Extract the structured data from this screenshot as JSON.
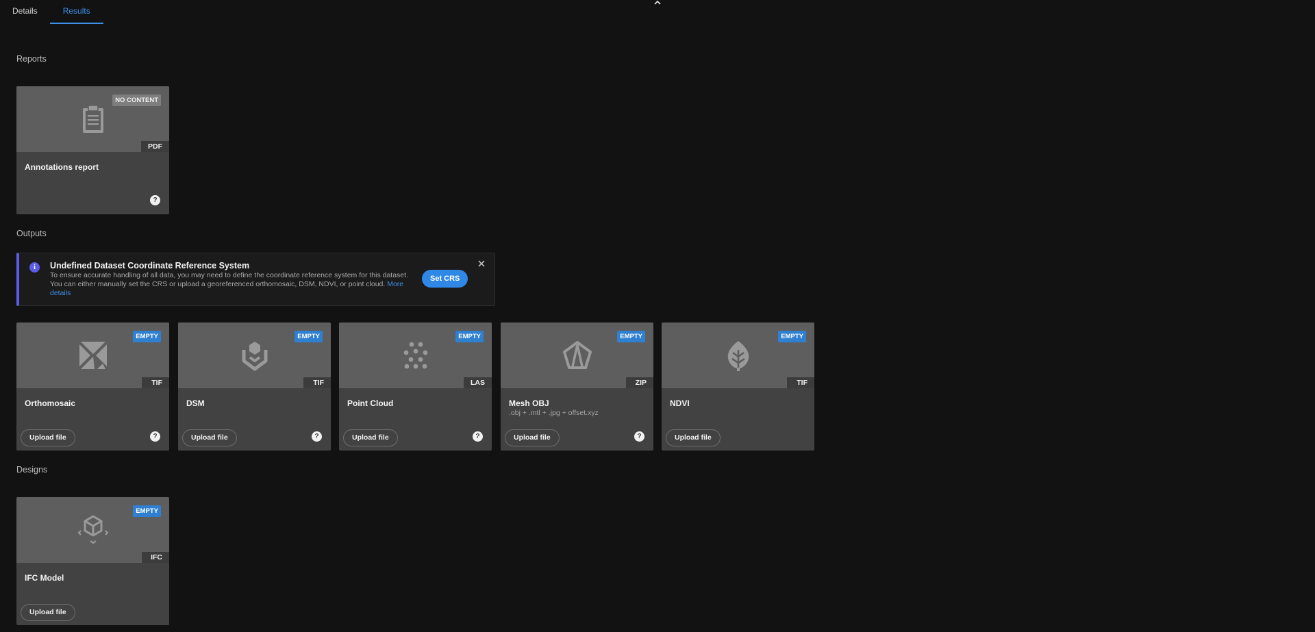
{
  "tabs": [
    {
      "label": "Details",
      "active": false
    },
    {
      "label": "Results",
      "active": true
    }
  ],
  "sections": {
    "reports": "Reports",
    "outputs": "Outputs",
    "designs": "Designs"
  },
  "reports": [
    {
      "title": "Annotations report",
      "badge": "NO CONTENT",
      "ext": "PDF",
      "icon": "clipboard-icon",
      "help": "?"
    }
  ],
  "alert": {
    "title": "Undefined Dataset Coordinate Reference System",
    "body": "To ensure accurate handling of all data, you may need to define the coordinate reference system for this dataset. You can either manually set the CRS or upload a georeferenced orthomosaic, DSM, NDVI, or point cloud.",
    "link": "More details",
    "button": "Set CRS",
    "info_glyph": "i"
  },
  "outputs": [
    {
      "title": "Orthomosaic",
      "subtitle": "",
      "badge": "EMPTY",
      "ext": "TIF",
      "icon": "orthomosaic-icon",
      "button": "Upload file",
      "help": "?"
    },
    {
      "title": "DSM",
      "subtitle": "",
      "badge": "EMPTY",
      "ext": "TIF",
      "icon": "dsm-icon",
      "button": "Upload file",
      "help": "?"
    },
    {
      "title": "Point Cloud",
      "subtitle": "",
      "badge": "EMPTY",
      "ext": "LAS",
      "icon": "point-cloud-icon",
      "button": "Upload file",
      "help": "?"
    },
    {
      "title": "Mesh OBJ",
      "subtitle": ".obj + .mtl + .jpg + offset.xyz",
      "badge": "EMPTY",
      "ext": "ZIP",
      "icon": "mesh-icon",
      "button": "Upload file",
      "help": "?"
    },
    {
      "title": "NDVI",
      "subtitle": "",
      "badge": "EMPTY",
      "ext": "TIF",
      "icon": "leaf-icon",
      "button": "Upload file",
      "help": ""
    }
  ],
  "designs": [
    {
      "title": "IFC Model",
      "badge": "EMPTY",
      "ext": "IFC",
      "icon": "cube-icon",
      "button": "Upload file"
    }
  ],
  "colors": {
    "background": "#121212",
    "card": "#424242",
    "thumb": "#5e5e5e",
    "accent": "#3d8fe8",
    "badge_empty": "#2f80d1",
    "alert_accent": "#5b5ce8"
  }
}
